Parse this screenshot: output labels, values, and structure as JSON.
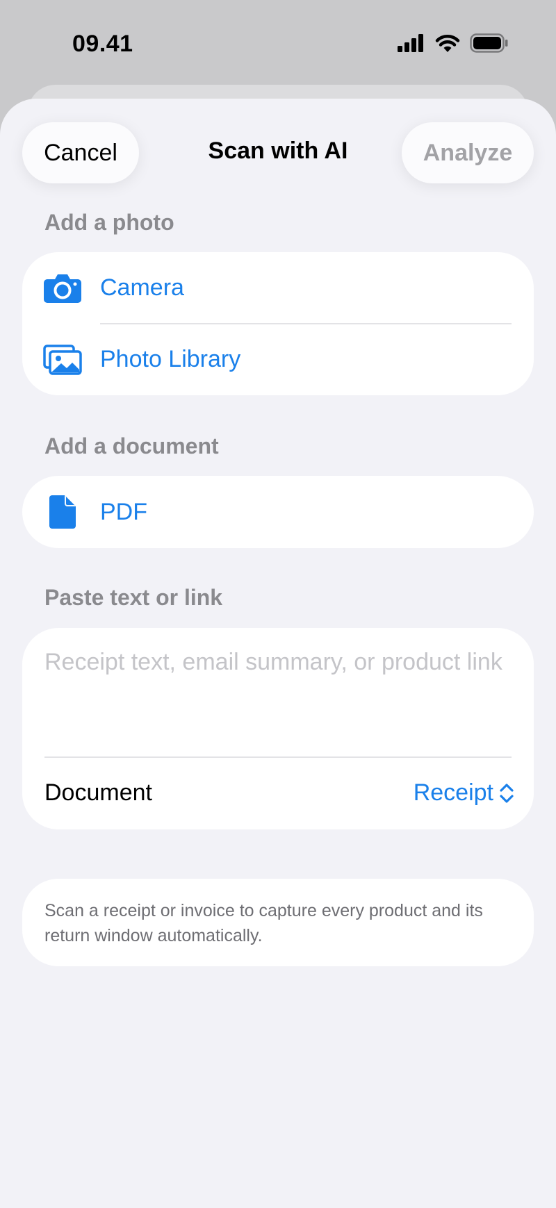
{
  "status": {
    "time": "09.41"
  },
  "nav": {
    "cancel": "Cancel",
    "title": "Scan with AI",
    "analyze": "Analyze"
  },
  "photo_section": {
    "label": "Add a photo",
    "items": [
      {
        "label": "Camera",
        "icon": "camera-icon"
      },
      {
        "label": "Photo Library",
        "icon": "photo-library-icon"
      }
    ]
  },
  "document_section": {
    "label": "Add a document",
    "items": [
      {
        "label": "PDF",
        "icon": "document-icon"
      }
    ]
  },
  "paste_section": {
    "label": "Paste text or link",
    "placeholder": "Receipt text, email summary, or product link",
    "document_label": "Document",
    "document_value": "Receipt"
  },
  "info": {
    "text": "Scan a receipt or invoice to capture every product and its return window automatically."
  },
  "colors": {
    "accent": "#1a80ea",
    "background": "#f2f2f7",
    "card": "#ffffff",
    "secondary_text": "#8a8a8e"
  }
}
